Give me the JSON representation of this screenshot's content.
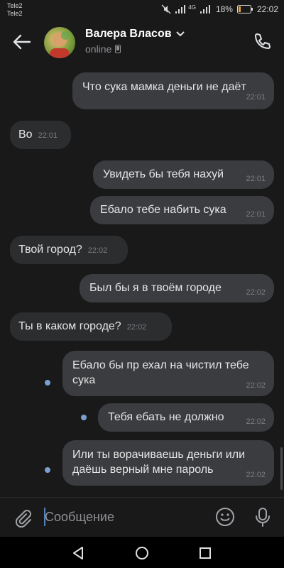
{
  "status_bar": {
    "carrier1": "Tele2",
    "carrier2": "Tele2",
    "network": "4G",
    "battery": "18%",
    "time": "22:02"
  },
  "header": {
    "contact_name": "Валера Власов",
    "status": "online"
  },
  "messages": [
    {
      "dir": "out",
      "text": "Что сука мамка деньги не даёт",
      "time": "22:01"
    },
    {
      "dir": "in",
      "text": "Во",
      "time": "22:01"
    },
    {
      "dir": "out",
      "text": "Увидеть бы тебя нахуй",
      "time": "22:01"
    },
    {
      "dir": "out",
      "text": "Ебало тебе набить сука",
      "time": "22:01"
    },
    {
      "dir": "in",
      "text": "Твой город?",
      "time": "22:02"
    },
    {
      "dir": "out",
      "text": "Был бы я в твоём городе",
      "time": "22:02"
    },
    {
      "dir": "in",
      "text": "Ты в каком городе?",
      "time": "22:02"
    },
    {
      "dir": "out",
      "text": "Ебало бы пр ехал на чистил тебе сука",
      "time": "22:02",
      "unread": true
    },
    {
      "dir": "out",
      "text": "Тебя ебать не должно",
      "time": "22:02",
      "unread": true
    },
    {
      "dir": "out",
      "text": "Или ты ворачиваешь деньги или даёшь верный мне пароль",
      "time": "22:02",
      "unread": true
    }
  ],
  "composer": {
    "placeholder": "Сообщение"
  },
  "colors": {
    "background": "#19191a",
    "outgoing_bubble": "#3a3c3f",
    "incoming_bubble": "#2c2d2f",
    "unread_dot": "#7a9fd1",
    "accent": "#5181b8"
  }
}
